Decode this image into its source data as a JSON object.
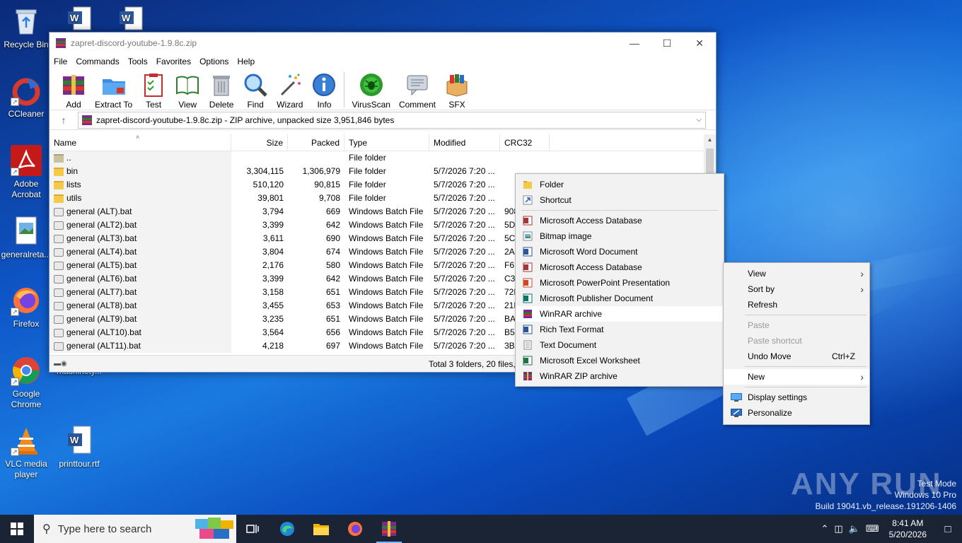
{
  "desktop": {
    "icons": [
      {
        "label": "Recycle Bin"
      },
      {
        "label": "CCleaner"
      },
      {
        "label": "Adobe Acrobat"
      },
      {
        "label": "generalreta..."
      },
      {
        "label": "Firefox"
      },
      {
        "label": "Google Chrome"
      },
      {
        "label": "VLC media player"
      },
      {
        "label": "machinety..."
      },
      {
        "label": "printtour.rtf"
      }
    ]
  },
  "winrar": {
    "title": "zapret-discord-youtube-1.9.8c.zip",
    "menu": [
      "File",
      "Commands",
      "Tools",
      "Favorites",
      "Options",
      "Help"
    ],
    "toolbar": [
      "Add",
      "Extract To",
      "Test",
      "View",
      "Delete",
      "Find",
      "Wizard",
      "Info",
      "VirusScan",
      "Comment",
      "SFX"
    ],
    "address": "zapret-discord-youtube-1.9.8c.zip - ZIP archive, unpacked size 3,951,846 bytes",
    "columns": [
      "Name",
      "Size",
      "Packed",
      "Type",
      "Modified",
      "CRC32"
    ],
    "rows": [
      {
        "name": "..",
        "size": "",
        "packed": "",
        "type": "File folder",
        "modified": "",
        "crc": "",
        "kind": "up"
      },
      {
        "name": "bin",
        "size": "3,304,115",
        "packed": "1,306,979",
        "type": "File folder",
        "modified": "5/7/2026 7:20 ...",
        "crc": "",
        "kind": "folder"
      },
      {
        "name": "lists",
        "size": "510,120",
        "packed": "90,815",
        "type": "File folder",
        "modified": "5/7/2026 7:20 ...",
        "crc": "",
        "kind": "folder"
      },
      {
        "name": "utils",
        "size": "39,801",
        "packed": "9,708",
        "type": "File folder",
        "modified": "5/7/2026 7:20 ...",
        "crc": "",
        "kind": "folder"
      },
      {
        "name": "general (ALT).bat",
        "size": "3,794",
        "packed": "669",
        "type": "Windows Batch File",
        "modified": "5/7/2026 7:20 ...",
        "crc": "908",
        "kind": "bat"
      },
      {
        "name": "general (ALT2).bat",
        "size": "3,399",
        "packed": "642",
        "type": "Windows Batch File",
        "modified": "5/7/2026 7:20 ...",
        "crc": "5D",
        "kind": "bat"
      },
      {
        "name": "general (ALT3).bat",
        "size": "3,611",
        "packed": "690",
        "type": "Windows Batch File",
        "modified": "5/7/2026 7:20 ...",
        "crc": "5C",
        "kind": "bat"
      },
      {
        "name": "general (ALT4).bat",
        "size": "3,804",
        "packed": "674",
        "type": "Windows Batch File",
        "modified": "5/7/2026 7:20 ...",
        "crc": "2A",
        "kind": "bat"
      },
      {
        "name": "general (ALT5).bat",
        "size": "2,176",
        "packed": "580",
        "type": "Windows Batch File",
        "modified": "5/7/2026 7:20 ...",
        "crc": "F6",
        "kind": "bat"
      },
      {
        "name": "general (ALT6).bat",
        "size": "3,399",
        "packed": "642",
        "type": "Windows Batch File",
        "modified": "5/7/2026 7:20 ...",
        "crc": "C3",
        "kind": "bat"
      },
      {
        "name": "general (ALT7).bat",
        "size": "3,158",
        "packed": "651",
        "type": "Windows Batch File",
        "modified": "5/7/2026 7:20 ...",
        "crc": "72E",
        "kind": "bat"
      },
      {
        "name": "general (ALT8).bat",
        "size": "3,455",
        "packed": "653",
        "type": "Windows Batch File",
        "modified": "5/7/2026 7:20 ...",
        "crc": "21E",
        "kind": "bat"
      },
      {
        "name": "general (ALT9).bat",
        "size": "3,235",
        "packed": "651",
        "type": "Windows Batch File",
        "modified": "5/7/2026 7:20 ...",
        "crc": "BA",
        "kind": "bat"
      },
      {
        "name": "general (ALT10).bat",
        "size": "3,564",
        "packed": "656",
        "type": "Windows Batch File",
        "modified": "5/7/2026 7:20 ...",
        "crc": "B5",
        "kind": "bat"
      },
      {
        "name": "general (ALT11).bat",
        "size": "4,218",
        "packed": "697",
        "type": "Windows Batch File",
        "modified": "5/7/2026 7:20 ...",
        "crc": "3B",
        "kind": "bat"
      }
    ],
    "status": "Total 3 folders, 20 files, 3,951,84"
  },
  "new_menu": [
    {
      "label": "Folder",
      "icon": "folder-icon",
      "group": 1
    },
    {
      "label": "Shortcut",
      "icon": "shortcut-icon",
      "group": 1
    },
    {
      "label": "Microsoft Access Database",
      "icon": "access-icon",
      "group": 2
    },
    {
      "label": "Bitmap image",
      "icon": "bitmap-icon",
      "group": 2
    },
    {
      "label": "Microsoft Word Document",
      "icon": "word-icon",
      "group": 2
    },
    {
      "label": "Microsoft Access Database",
      "icon": "access-icon",
      "group": 2
    },
    {
      "label": "Microsoft PowerPoint Presentation",
      "icon": "powerpoint-icon",
      "group": 2
    },
    {
      "label": "Microsoft Publisher Document",
      "icon": "publisher-icon",
      "group": 2
    },
    {
      "label": "WinRAR archive",
      "icon": "winrar-icon",
      "group": 2,
      "highlight": true
    },
    {
      "label": "Rich Text Format",
      "icon": "rtf-icon",
      "group": 2
    },
    {
      "label": "Text Document",
      "icon": "text-icon",
      "group": 2
    },
    {
      "label": "Microsoft Excel Worksheet",
      "icon": "excel-icon",
      "group": 2
    },
    {
      "label": "WinRAR ZIP archive",
      "icon": "winrar-zip-icon",
      "group": 2
    }
  ],
  "desktop_menu": {
    "view": "View",
    "sort_by": "Sort by",
    "refresh": "Refresh",
    "paste": "Paste",
    "paste_shortcut": "Paste shortcut",
    "undo_move": "Undo Move",
    "undo_shortcut": "Ctrl+Z",
    "new": "New",
    "display_settings": "Display settings",
    "personalize": "Personalize"
  },
  "watermark": {
    "brand": "ANY RUN",
    "line1": "Test Mode",
    "line2": "Windows 10 Pro",
    "line3": "Build 19041.vb_release.191206-1406"
  },
  "taskbar": {
    "search_placeholder": "Type here to search",
    "time": "8:41 AM",
    "date": "5/20/2026"
  },
  "colors": {
    "taskbar": "#1b2434",
    "menu_bg": "#f2f2f2",
    "accent": "#0078d7"
  }
}
